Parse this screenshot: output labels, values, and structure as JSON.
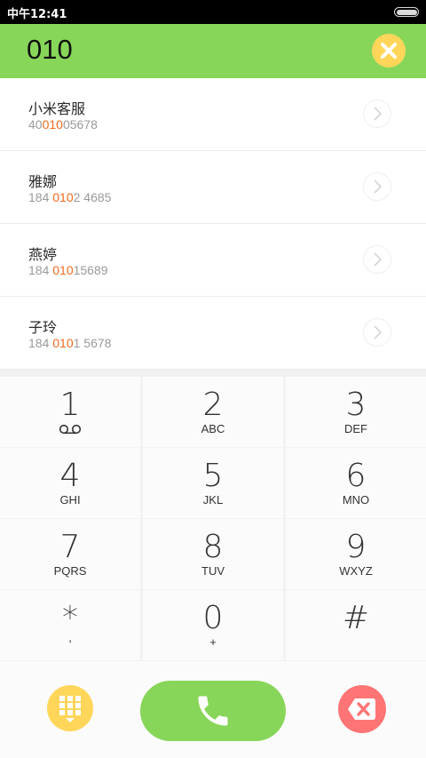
{
  "status_bar": {
    "time": "中午12:41"
  },
  "dialer": {
    "query": "010"
  },
  "results": [
    {
      "name": "小米客服",
      "number_pre": "40",
      "number_match": "010",
      "number_post": "05678"
    },
    {
      "name": "雅娜",
      "number_pre": "184 ",
      "number_match": "010",
      "number_post": "2 4685"
    },
    {
      "name": "燕婷",
      "number_pre": "184 ",
      "number_match": "010",
      "number_post": "15689"
    },
    {
      "name": "子玲",
      "number_pre": "184 ",
      "number_match": "010",
      "number_post": "1 5678"
    }
  ],
  "keypad": [
    {
      "digit": "1",
      "letters": "",
      "icon": "voicemail-icon"
    },
    {
      "digit": "2",
      "letters": "ABC"
    },
    {
      "digit": "3",
      "letters": "DEF"
    },
    {
      "digit": "4",
      "letters": "GHI"
    },
    {
      "digit": "5",
      "letters": "JKL"
    },
    {
      "digit": "6",
      "letters": "MNO"
    },
    {
      "digit": "7",
      "letters": "PQRS"
    },
    {
      "digit": "8",
      "letters": "TUV"
    },
    {
      "digit": "9",
      "letters": "WXYZ"
    },
    {
      "digit": "*",
      "letters": ","
    },
    {
      "digit": "0",
      "letters": "+"
    },
    {
      "digit": "#",
      "letters": ""
    }
  ],
  "colors": {
    "header": "#88d659",
    "accent_yellow": "#ffd65a",
    "call_green": "#88d659",
    "delete_red": "#ff7575",
    "match_highlight": "#f26a1d"
  },
  "icons": {
    "clear": "close-icon",
    "detail": "chevron-right-icon",
    "dialpad": "dialpad-icon",
    "call": "phone-icon",
    "delete": "backspace-icon"
  }
}
